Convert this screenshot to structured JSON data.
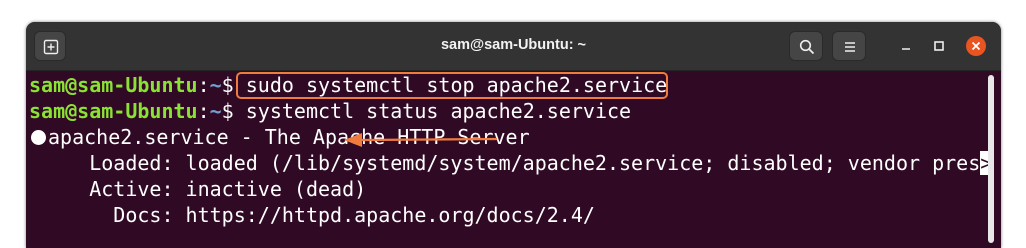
{
  "window": {
    "title": "sam@sam-Ubuntu: ~"
  },
  "toolbar": {
    "new_tab_icon": "new-tab-icon",
    "search_icon": "search-icon",
    "menu_icon": "hamburger-menu-icon",
    "minimize_icon": "minimize-icon",
    "maximize_icon": "maximize-icon",
    "close_icon": "close-icon"
  },
  "terminal": {
    "lines": [
      {
        "user_host": "sam@sam-Ubuntu",
        "sep": ":",
        "path": "~",
        "prompt": "$ ",
        "command": "sudo systemctl stop apache2.service"
      },
      {
        "user_host": "sam@sam-Ubuntu",
        "sep": ":",
        "path": "~",
        "prompt": "$ ",
        "command": "systemctl status apache2.service"
      }
    ],
    "output": {
      "unit_line": "apache2.service - The Apache HTTP Server",
      "loaded_line": "     Loaded: loaded (/lib/systemd/system/apache2.service; disabled; vendor pres",
      "truncation_marker": ">",
      "active_line": "     Active: inactive (dead)",
      "docs_line": "       Docs: https://httpd.apache.org/docs/2.4/"
    }
  },
  "colors": {
    "terminal_bg": "#300a24",
    "user_host": "#8ae234",
    "path": "#729fcf",
    "highlight": "#f07b3f",
    "titlebar_bg": "#333333"
  }
}
